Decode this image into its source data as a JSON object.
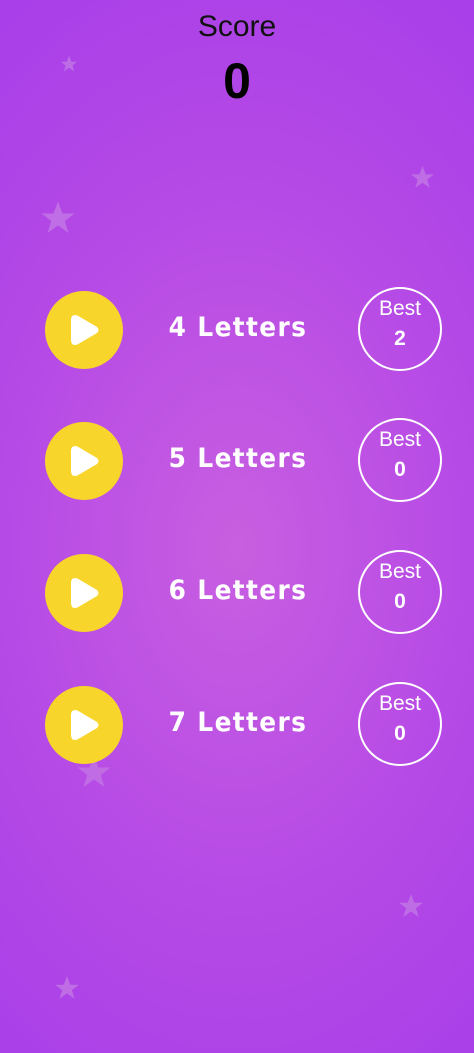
{
  "score": {
    "label": "Score",
    "value": "0"
  },
  "levels": [
    {
      "label": "4 Letters",
      "best_label": "Best",
      "best_value": "2"
    },
    {
      "label": "5 Letters",
      "best_label": "Best",
      "best_value": "0"
    },
    {
      "label": "6 Letters",
      "best_label": "Best",
      "best_value": "0"
    },
    {
      "label": "7 Letters",
      "best_label": "Best",
      "best_value": "0"
    }
  ],
  "colors": {
    "background": "#b64ae6",
    "play_button": "#f7d52a",
    "text": "#ffffff",
    "stars": "#c77ee6"
  },
  "icons": {
    "play": "play-icon",
    "star": "star-icon"
  }
}
